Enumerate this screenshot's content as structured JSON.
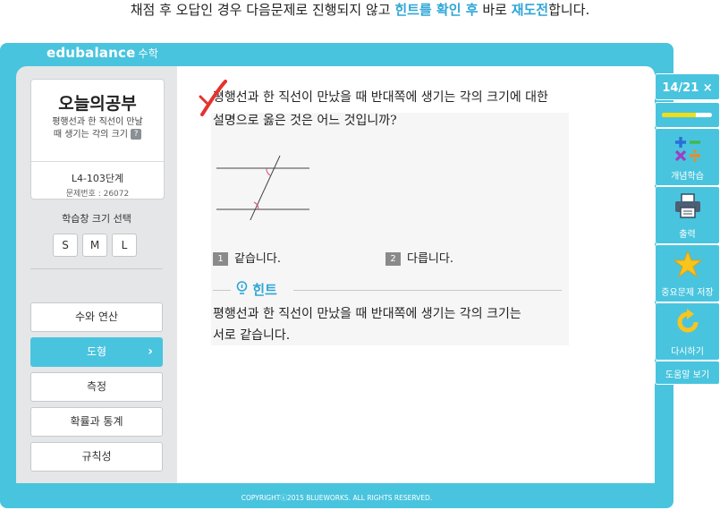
{
  "caption": {
    "part1": "채점 후 오답인 경우 다음문제로 진행되지 않고 ",
    "highlight1": "힌트를 확인 후",
    "part2": " 바로 ",
    "highlight2": "재도전",
    "part3": "합니다."
  },
  "app": {
    "logo": "edubalance",
    "logo_sub": "수학"
  },
  "topic": {
    "title": "오늘의공부",
    "desc_line1": "평행선과 한 직선이 만날",
    "desc_line2": "때 생기는 각의 크기",
    "help_icon": "?",
    "lesson_code": "L4-103단계",
    "problem_no": "문제번호 : 26072"
  },
  "size_select": {
    "label": "학습창 크기 선택",
    "options": [
      "S",
      "M",
      "L"
    ]
  },
  "menu": [
    {
      "label": "수와 연산",
      "active": false
    },
    {
      "label": "도형",
      "active": true,
      "chevron": "›"
    },
    {
      "label": "측정",
      "active": false
    },
    {
      "label": "확률과 통계",
      "active": false
    },
    {
      "label": "규칙성",
      "active": false
    }
  ],
  "question": {
    "line1": "평행선과 한 직선이 만났을 때 반대쪽에 생기는 각의 크기에 대한",
    "line2": "설명으로 옳은 것은 어느 것입니까?",
    "choices": [
      {
        "num": "1",
        "text": "같습니다."
      },
      {
        "num": "2",
        "text": "다릅니다."
      }
    ],
    "hint_title": "힌트",
    "hint_line1": "평행선과 한 직선이 만났을 때 반대쪽에 생기는 각의 크기는",
    "hint_line2": "서로 같습니다."
  },
  "right_panel": {
    "counter": "14/21",
    "close_icon": "×",
    "progress": 0.67,
    "concept_label": "개념학습",
    "print_label": "출력",
    "save_label": "중요문제 저장",
    "retry_label": "다시하기",
    "help_label": "도움말 보기"
  },
  "colors": {
    "accent": "#49c4de",
    "highlight": "#2ea6d6",
    "progress": "#f2de18",
    "wrong_mark": "#e5322d"
  },
  "footer": "COPYRIGHTⓒ2015 BLUEWORKS. ALL RIGHTS RESERVED."
}
